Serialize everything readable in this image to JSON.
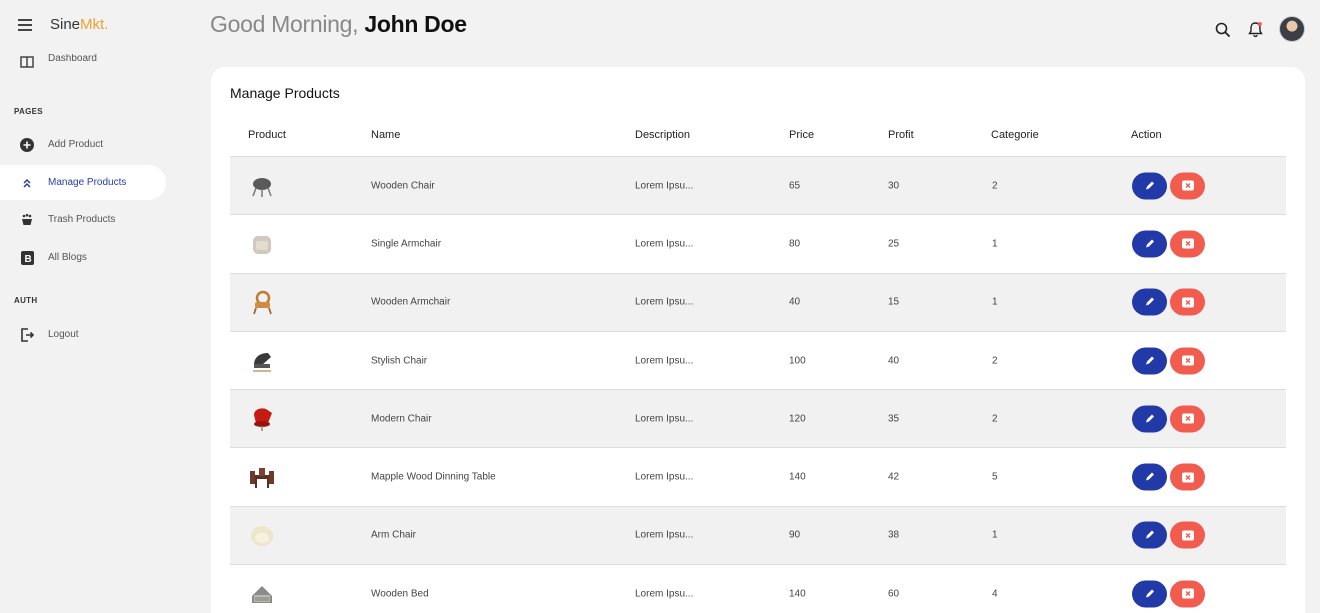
{
  "brand": {
    "part1": "Sine",
    "part2": "Mkt."
  },
  "sidebar": {
    "dashboard_label": "Dashboard",
    "pages_section": "PAGES",
    "items": [
      {
        "label": "Add Product",
        "icon": "plus-circle-icon"
      },
      {
        "label": "Manage Products",
        "icon": "chevrons-up-icon"
      },
      {
        "label": "Trash Products",
        "icon": "trash-basket-icon"
      },
      {
        "label": "All Blogs",
        "icon": "blogger-icon"
      }
    ],
    "auth_section": "AUTH",
    "logout_label": "Logout"
  },
  "header": {
    "greeting": "Good Morning,",
    "user_name": "John Doe"
  },
  "colors": {
    "accent": "#223aa8",
    "delete": "#f25c4f",
    "brand_accent": "#f0a030"
  },
  "table": {
    "title": "Manage Products",
    "columns": [
      "Product",
      "Name",
      "Description",
      "Price",
      "Profit",
      "Categorie",
      "Action"
    ],
    "rows": [
      {
        "name": "Wooden Chair",
        "description": "Lorem Ipsu...",
        "price": "65",
        "profit": "30",
        "category": "2"
      },
      {
        "name": "Single Armchair",
        "description": "Lorem Ipsu...",
        "price": "80",
        "profit": "25",
        "category": "1"
      },
      {
        "name": "Wooden Armchair",
        "description": "Lorem Ipsu...",
        "price": "40",
        "profit": "15",
        "category": "1"
      },
      {
        "name": "Stylish Chair",
        "description": "Lorem Ipsu...",
        "price": "100",
        "profit": "40",
        "category": "2"
      },
      {
        "name": "Modern Chair",
        "description": "Lorem Ipsu...",
        "price": "120",
        "profit": "35",
        "category": "2"
      },
      {
        "name": "Mapple Wood Dinning Table",
        "description": "Lorem Ipsu...",
        "price": "140",
        "profit": "42",
        "category": "5"
      },
      {
        "name": "Arm Chair",
        "description": "Lorem Ipsu...",
        "price": "90",
        "profit": "38",
        "category": "1"
      },
      {
        "name": "Wooden Bed",
        "description": "Lorem Ipsu...",
        "price": "140",
        "profit": "60",
        "category": "4"
      }
    ]
  }
}
